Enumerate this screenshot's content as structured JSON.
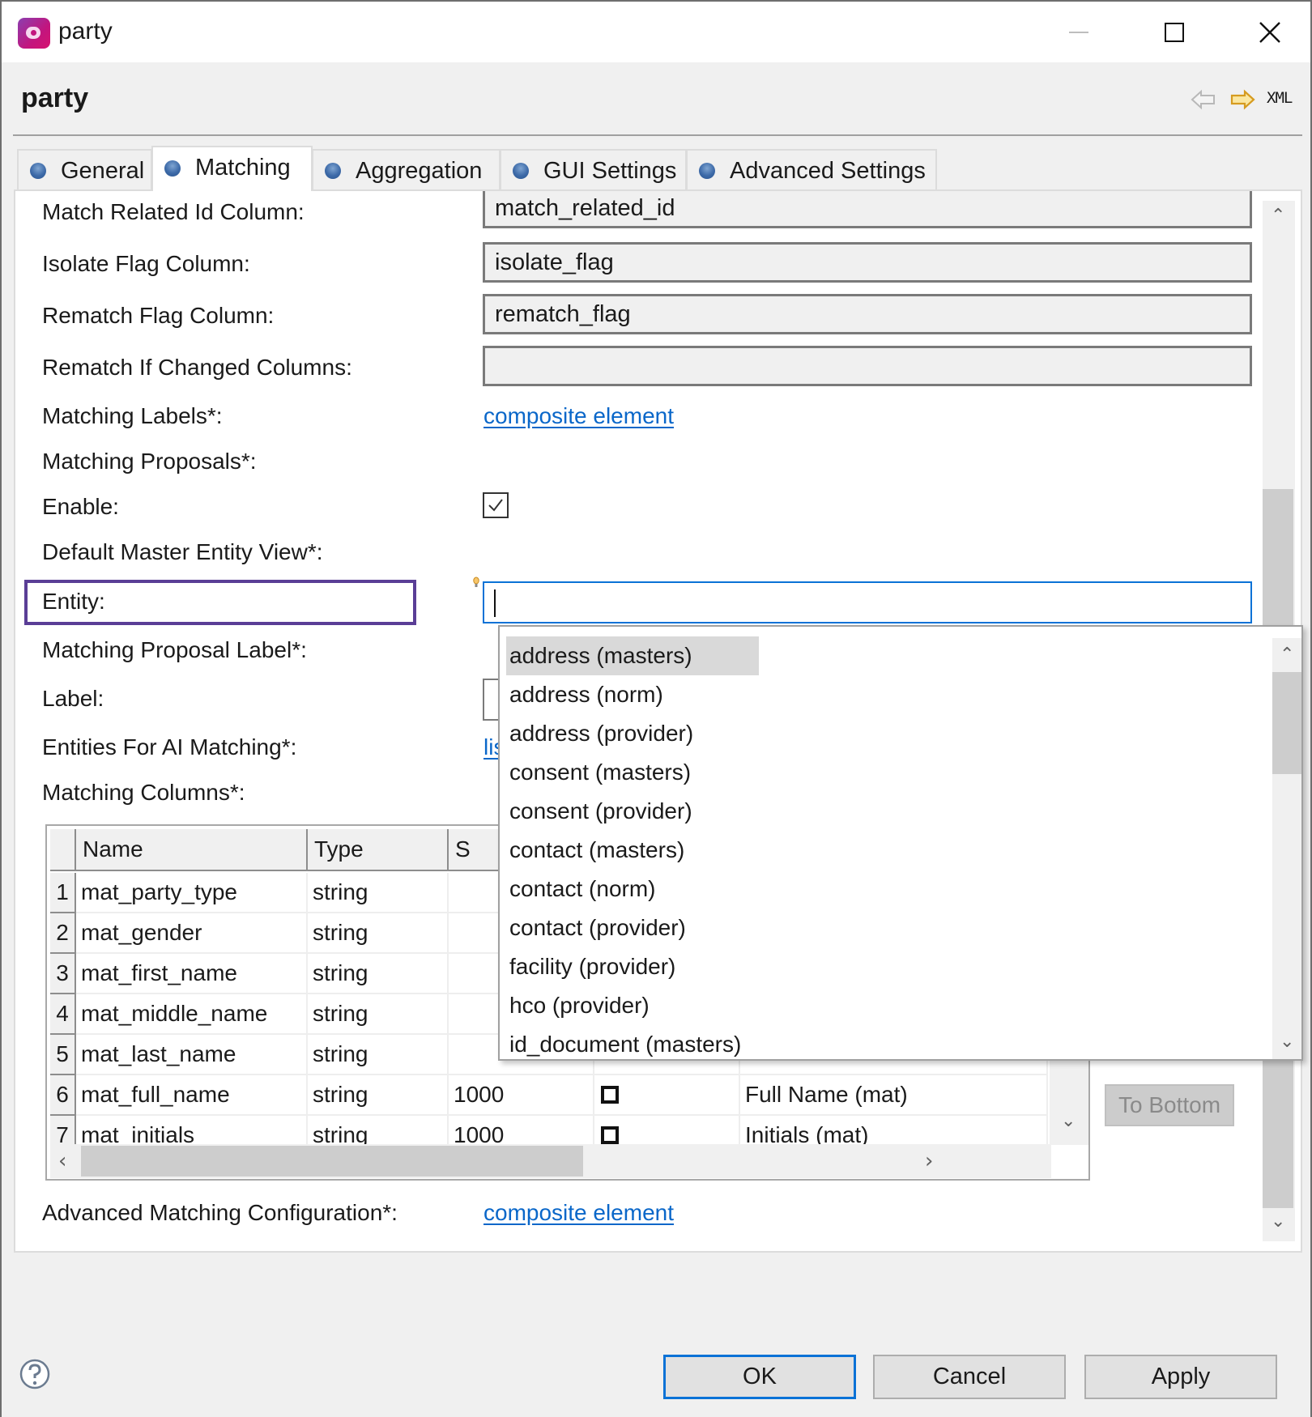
{
  "window": {
    "title": "party",
    "icon": "ataccama-app-icon",
    "controls": [
      "minimize-icon",
      "maximize-icon",
      "close-icon"
    ]
  },
  "header": {
    "title": "party",
    "nav_back_icon": "arrow-left-icon",
    "nav_forward_icon": "arrow-right-icon",
    "xml_label": "XML"
  },
  "tabs": [
    {
      "label": "General",
      "active": false
    },
    {
      "label": "Matching",
      "active": true
    },
    {
      "label": "Aggregation",
      "active": false
    },
    {
      "label": "GUI Settings",
      "active": false
    },
    {
      "label": "Advanced Settings",
      "active": false
    }
  ],
  "form": {
    "match_related_id": {
      "label": "Match Related Id Column:",
      "value": "match_related_id"
    },
    "isolate_flag": {
      "label": "Isolate Flag Column:",
      "value": "isolate_flag"
    },
    "rematch_flag": {
      "label": "Rematch Flag Column:",
      "value": "rematch_flag"
    },
    "rematch_if_changed": {
      "label": "Rematch If Changed Columns:",
      "value": ""
    },
    "matching_labels": {
      "label": "Matching Labels*:",
      "link": "composite element"
    },
    "matching_proposals": {
      "label": "Matching Proposals*:"
    },
    "enable": {
      "label": "Enable:",
      "checked": true
    },
    "default_master_entity_view": {
      "label": "Default Master Entity View*:"
    },
    "entity": {
      "label": "Entity:",
      "value": ""
    },
    "matching_proposal_label": {
      "label": "Matching Proposal Label*:"
    },
    "label": {
      "label": "Label:",
      "value": ""
    },
    "entities_for_ai": {
      "label": "Entities For AI Matching*:",
      "link_partial": "lis"
    },
    "matching_columns": {
      "label": "Matching Columns*:"
    },
    "advanced_matching": {
      "label": "Advanced Matching Configuration*:",
      "link": "composite element"
    }
  },
  "matching_columns_table": {
    "columns": [
      "Name",
      "Type",
      "S"
    ],
    "rows": [
      {
        "num": "1",
        "name": "mat_party_type",
        "type": "string",
        "size": "",
        "flag": false,
        "label": ""
      },
      {
        "num": "2",
        "name": "mat_gender",
        "type": "string",
        "size": "",
        "flag": false,
        "label": ""
      },
      {
        "num": "3",
        "name": "mat_first_name",
        "type": "string",
        "size": "",
        "flag": false,
        "label": ""
      },
      {
        "num": "4",
        "name": "mat_middle_name",
        "type": "string",
        "size": "",
        "flag": false,
        "label": ""
      },
      {
        "num": "5",
        "name": "mat_last_name",
        "type": "string",
        "size": "",
        "flag": false,
        "label": ""
      },
      {
        "num": "6",
        "name": "mat_full_name",
        "type": "string",
        "size": "1000",
        "flag": false,
        "label": "Full Name (mat)"
      },
      {
        "num": "7",
        "name": "mat_initials",
        "type": "string",
        "size": "1000",
        "flag": false,
        "label": "Initials (mat)"
      }
    ],
    "side_buttons": {
      "to_bottom": "To Bottom"
    }
  },
  "entity_dropdown": {
    "selected_index": 0,
    "options": [
      "address (masters)",
      "address (norm)",
      "address (provider)",
      "consent (masters)",
      "consent (provider)",
      "contact (masters)",
      "contact (norm)",
      "contact (provider)",
      "facility (provider)",
      "hco (provider)",
      "id_document (masters)"
    ]
  },
  "footer": {
    "help_icon": "help-icon",
    "ok_label": "OK",
    "cancel_label": "Cancel",
    "apply_label": "Apply"
  },
  "colors": {
    "accent": "#0a72d6",
    "link": "#0a67c9",
    "highlight_box": "#5a3e96",
    "tab_dot": "#3d6aa8"
  }
}
